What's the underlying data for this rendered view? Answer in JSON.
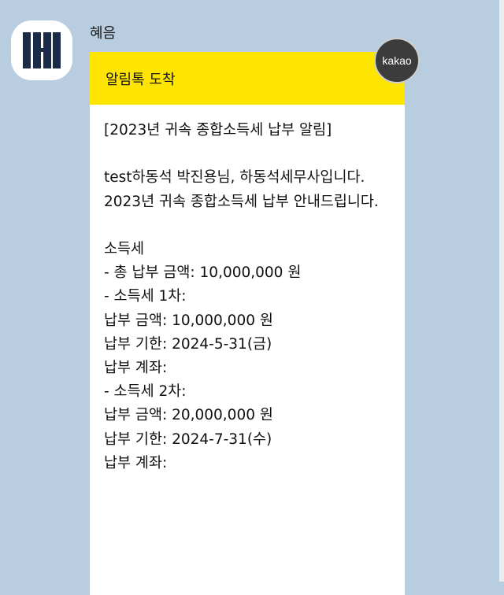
{
  "sender": {
    "name": "혜음",
    "avatar_icon": "building-logo-icon"
  },
  "message": {
    "header": "알림톡 도착",
    "body": "[2023년 귀속 종합소득세 납부 알림]\n\ntest하동석 박진용님, 하동석세무사입니다.\n2023년 귀속 종합소득세 납부 안내드립니다.\n\n소득세\n- 총 납부 금액: 10,000,000 원\n- 소득세 1차:\n납부 금액: 10,000,000 원\n납부 기한: 2024-5-31(금)\n납부 계좌:\n- 소득세 2차:\n납부 금액: 20,000,000 원\n납부 기한: 2024-7-31(수)\n납부 계좌:",
    "badge": "kakao"
  },
  "colors": {
    "background": "#b9cde1",
    "header_yellow": "#fee500",
    "logo_navy": "#1c2a4a"
  }
}
